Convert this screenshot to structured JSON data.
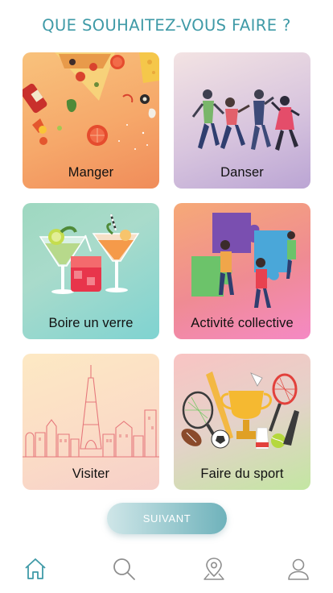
{
  "header": {
    "title": "QUE SOUHAITEZ-VOUS FAIRE ?"
  },
  "activities": [
    {
      "label": "Manger",
      "illustration": "food-icon"
    },
    {
      "label": "Danser",
      "illustration": "dancers-icon"
    },
    {
      "label": "Boire un verre",
      "illustration": "cocktail-icon"
    },
    {
      "label": "Activité collective",
      "illustration": "puzzle-team-icon"
    },
    {
      "label": "Visiter",
      "illustration": "paris-eiffel-icon"
    },
    {
      "label": "Faire du sport",
      "illustration": "sports-trophy-icon"
    }
  ],
  "actions": {
    "next_label": "SUIVANT"
  },
  "tabbar": {
    "items": [
      {
        "icon": "home-icon",
        "active": true
      },
      {
        "icon": "search-icon",
        "active": false
      },
      {
        "icon": "map-pin-icon",
        "active": false
      },
      {
        "icon": "user-icon",
        "active": false
      }
    ]
  },
  "colors": {
    "accent": "#3f9aa7",
    "inactive_icon": "#8e8e8e"
  }
}
